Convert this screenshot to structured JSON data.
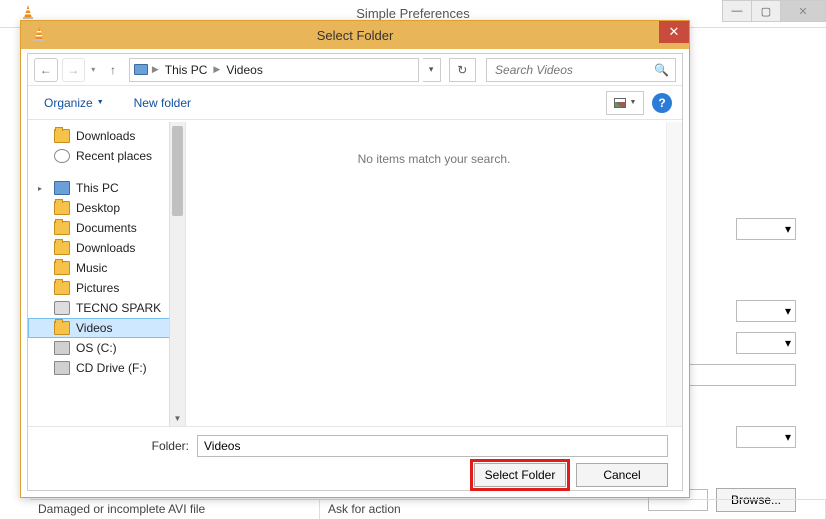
{
  "parent": {
    "title": "Simple Preferences",
    "browse_label": "Browse...",
    "bottom_left": "Damaged or incomplete AVI file",
    "bottom_right": "Ask for action"
  },
  "dialog": {
    "title": "Select Folder",
    "breadcrumb": {
      "root": "This PC",
      "leaf": "Videos"
    },
    "search_placeholder": "Search Videos",
    "toolbar": {
      "organize": "Organize",
      "new_folder": "New folder"
    },
    "empty_message": "No items match your search.",
    "tree": {
      "top1": "Downloads",
      "top2": "Recent places",
      "root": "This PC",
      "items": [
        {
          "label": "Desktop",
          "icon": "folder"
        },
        {
          "label": "Documents",
          "icon": "folder"
        },
        {
          "label": "Downloads",
          "icon": "folder"
        },
        {
          "label": "Music",
          "icon": "folder"
        },
        {
          "label": "Pictures",
          "icon": "folder"
        },
        {
          "label": "TECNO SPARK",
          "icon": "phone"
        },
        {
          "label": "Videos",
          "icon": "folder",
          "selected": true
        },
        {
          "label": "OS (C:)",
          "icon": "drive"
        },
        {
          "label": "CD Drive (F:)",
          "icon": "drive"
        }
      ]
    },
    "footer": {
      "label": "Folder:",
      "value": "Videos",
      "primary": "Select Folder",
      "cancel": "Cancel"
    }
  }
}
